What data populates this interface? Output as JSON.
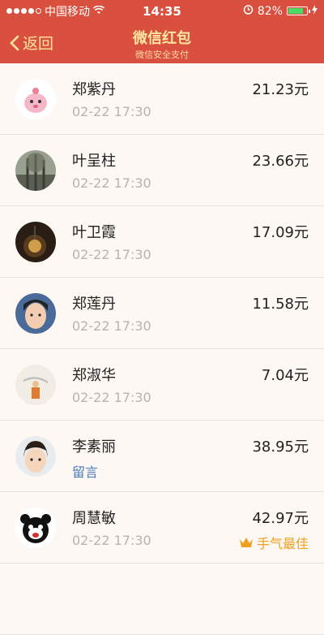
{
  "status": {
    "carrier": "中国移动",
    "time": "14:35",
    "battery": "82%",
    "battery_level": 0.82
  },
  "nav": {
    "back_label": "返回",
    "title": "微信红包",
    "subtitle": "微信安全支付"
  },
  "rows": [
    {
      "name": "郑紫丹",
      "amount": "21.23元",
      "time": "02-22 17:30"
    },
    {
      "name": "叶呈柱",
      "amount": "23.66元",
      "time": "02-22 17:30"
    },
    {
      "name": "叶卫霞",
      "amount": "17.09元",
      "time": "02-22 17:30"
    },
    {
      "name": "郑莲丹",
      "amount": "11.58元",
      "time": "02-22 17:30"
    },
    {
      "name": "郑淑华",
      "amount": "7.04元",
      "time": "02-22 17:30"
    },
    {
      "name": "李素丽",
      "amount": "38.95元",
      "message": "留言"
    },
    {
      "name": "周慧敏",
      "amount": "42.97元",
      "time": "02-22 17:30",
      "badge": "手气最佳"
    }
  ],
  "colors": {
    "header": "#d9503f",
    "title": "#ffe6a1",
    "link": "#4a7ab8",
    "best": "#f0a020"
  }
}
